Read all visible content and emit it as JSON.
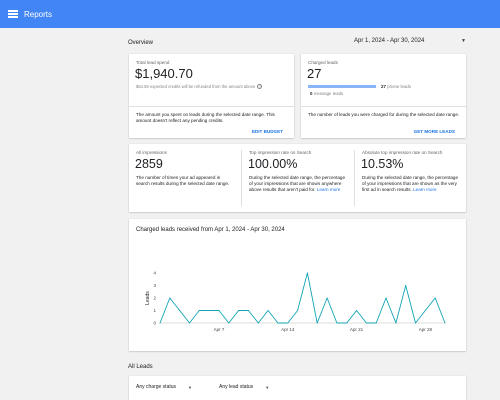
{
  "topbar": {
    "title": "Reports",
    "menu_icon": "hamburger-menu-icon"
  },
  "overview": {
    "label": "Overview",
    "date_range": "Apr 1, 2024 - Apr 30, 2024"
  },
  "total_spent": {
    "label": "Total lead spend",
    "value": "$1,940.70",
    "note": "$64.55 expected credits will be refunded from the amount above",
    "info_icon": "info-circle-icon",
    "description": "The amount you spent on leads during the selected date range. This amount doesn't reflect any pending credits.",
    "action": "EDIT BUDGET"
  },
  "charged_leads": {
    "label": "Charged leads",
    "value": "27",
    "phone_count": "27",
    "phone_label": "phone leads",
    "message_count": "0",
    "message_label": "message leads",
    "phone_fraction": 1.0,
    "message_fraction": 0.0,
    "description": "The number of leads you were charged for during the selected date range.",
    "action": "GET MORE LEADS"
  },
  "impressions": {
    "label": "All impressions",
    "value": "2859",
    "description": "The number of times your ad appeared in search results during the selected date range."
  },
  "top_rate": {
    "label": "Top impression rate on Search",
    "value": "100.00%",
    "description": "During the selected date range, the percentage of your impressions that are shown anywhere above results that aren't paid for.",
    "link": "Learn more"
  },
  "abs_top_rate": {
    "label": "Absolute top impression rate on Search",
    "value": "10.53%",
    "description": "During the selected date range, the percentage of your impressions that are shown as the very first ad in search results.",
    "link": "Learn more"
  },
  "chart_title": "Charged leads received from Apr 1, 2024 - Apr 30, 2024",
  "chart_data": {
    "type": "line",
    "title": "Charged leads received from Apr 1, 2024 - Apr 30, 2024",
    "xlabel": "",
    "ylabel": "Leads",
    "ylim": [
      0,
      4
    ],
    "y_ticks": [
      "0",
      "1",
      "2",
      "3",
      "4"
    ],
    "x_tick_labels": [
      {
        "day": 7,
        "label": "Apr 7"
      },
      {
        "day": 14,
        "label": "Apr 14"
      },
      {
        "day": 21,
        "label": "Apr 21"
      },
      {
        "day": 28,
        "label": "Apr 28"
      }
    ],
    "color": "#12a4b4",
    "series": [
      {
        "x": [
          1,
          2,
          3,
          4,
          5,
          6,
          7,
          8,
          9,
          10,
          11,
          12,
          13,
          14,
          15,
          16,
          17,
          18,
          19,
          20,
          21,
          22,
          23,
          24,
          25,
          26,
          27,
          28,
          29,
          30
        ],
        "y": [
          0,
          2,
          1,
          0,
          1,
          1,
          1,
          0,
          1,
          1,
          0,
          1,
          0,
          0,
          1,
          4,
          0,
          2,
          0,
          0,
          1,
          0,
          0,
          2,
          0,
          3,
          0,
          1,
          2,
          0
        ]
      }
    ],
    "grid": false
  },
  "all_leads": {
    "label": "All Leads",
    "filter_charge": "Any charge status",
    "filter_lead": "Any lead status"
  }
}
